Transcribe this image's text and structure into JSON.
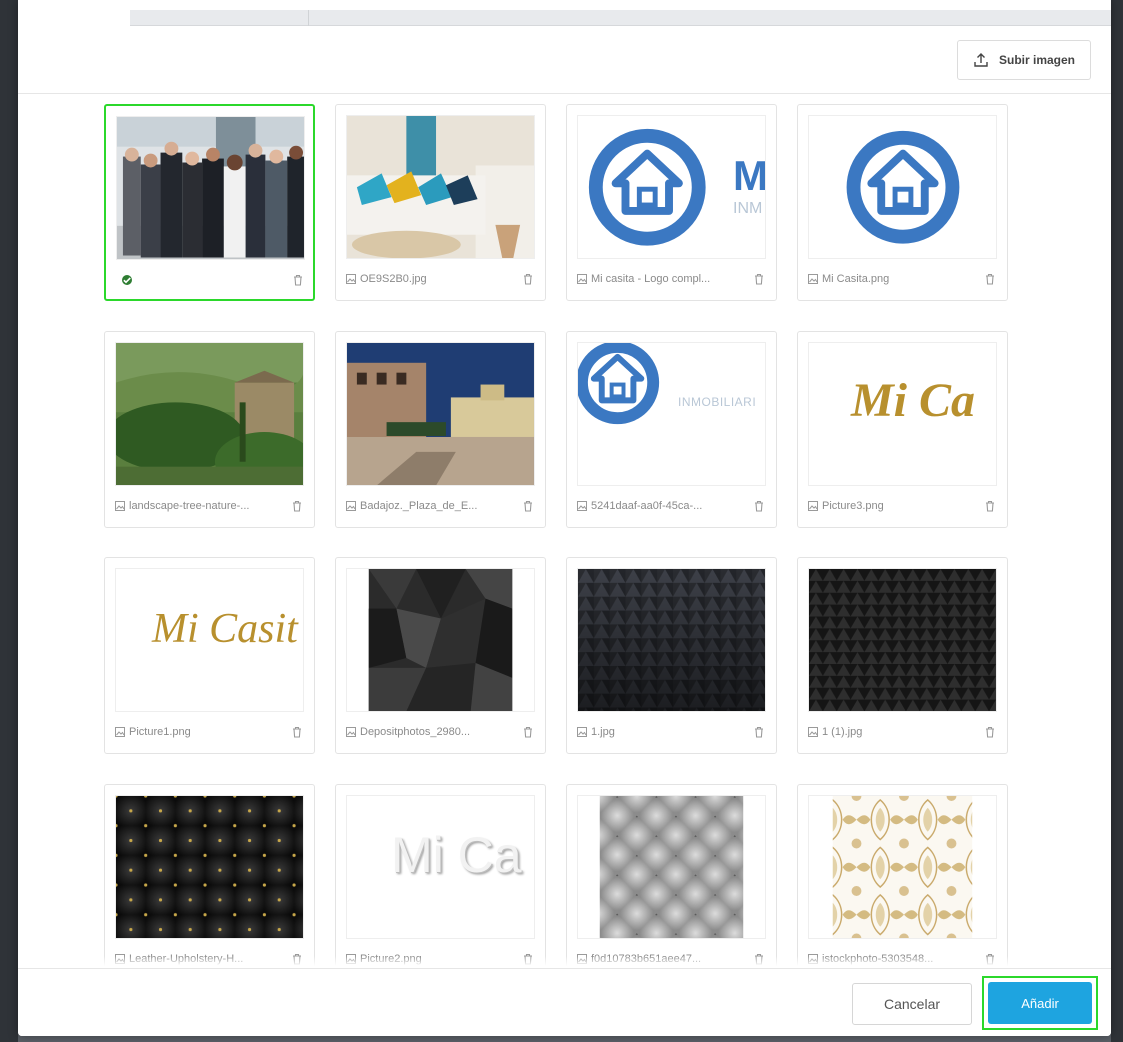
{
  "header": {
    "upload_button_label": "Subir imagen"
  },
  "gallery": {
    "items": [
      {
        "filename": "",
        "selected": true,
        "thumb": "business-team-photo"
      },
      {
        "filename": "OE9S2B0.jpg",
        "selected": false,
        "thumb": "living-room-photo"
      },
      {
        "filename": "Mi casita - Logo compl...",
        "selected": false,
        "thumb": "mi-casita-full-logo"
      },
      {
        "filename": "Mi Casita.png",
        "selected": false,
        "thumb": "mi-casita-house-logo"
      },
      {
        "filename": "landscape-tree-nature-...",
        "selected": false,
        "thumb": "landscape-photo"
      },
      {
        "filename": "Badajoz._Plaza_de_E...",
        "selected": false,
        "thumb": "plaza-photo"
      },
      {
        "filename": "5241daaf-aa0f-45ca-...",
        "selected": false,
        "thumb": "inmobiliaria-logo"
      },
      {
        "filename": "Picture3.png",
        "selected": false,
        "thumb": "gold-script-text"
      },
      {
        "filename": "Picture1.png",
        "selected": false,
        "thumb": "gold-script-text-2"
      },
      {
        "filename": "Depositphotos_2980...",
        "selected": false,
        "thumb": "dark-polygon-texture"
      },
      {
        "filename": "1.jpg",
        "selected": false,
        "thumb": "dark-triangle-texture"
      },
      {
        "filename": "1 (1).jpg",
        "selected": false,
        "thumb": "black-triangle-texture"
      },
      {
        "filename": "Leather-Upholstery-H...",
        "selected": false,
        "thumb": "black-leather-texture"
      },
      {
        "filename": "Picture2.png",
        "selected": false,
        "thumb": "embossed-text"
      },
      {
        "filename": "f0d10783b651aee47...",
        "selected": false,
        "thumb": "grey-tufted-texture"
      },
      {
        "filename": "istockphoto-5303548...",
        "selected": false,
        "thumb": "gold-damask-pattern"
      }
    ],
    "thumb_text": {
      "logo_letter": "M",
      "logo_sub": "INM",
      "inmobiliaria": "INMOBILIARI",
      "script_a": "Mi Ca",
      "script_b": "Mi Casit",
      "embossed": "Mi Ca"
    }
  },
  "footer": {
    "cancel_label": "Cancelar",
    "add_label": "Añadir"
  },
  "colors": {
    "accent": "#1ea4e0",
    "selection": "#2bd82b",
    "logo_blue": "#3b78c2",
    "script_gold": "#b8902e"
  }
}
